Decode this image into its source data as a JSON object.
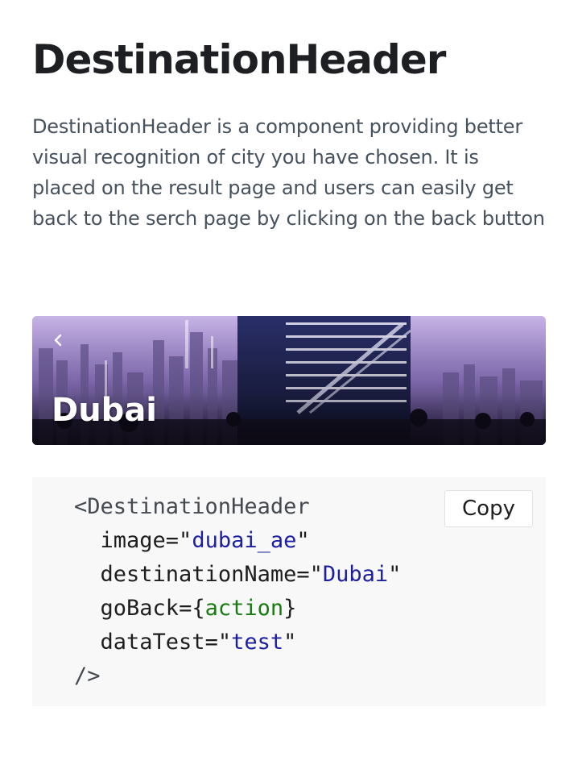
{
  "page": {
    "title": "DestinationHeader",
    "description": "DestinationHeader is a component providing better visual recognition of city you have chosen. It is placed on the result page and users can easily get back to the serch page by clicking on the back button"
  },
  "preview": {
    "destination_name": "Dubai",
    "back_icon": "chevron-left-icon"
  },
  "code": {
    "open_tag": "<DestinationHeader",
    "props": [
      {
        "name": "image",
        "op": "=\"",
        "value": "dubai_ae",
        "close": "\"",
        "kind": "str"
      },
      {
        "name": "destinationName",
        "op": "=\"",
        "value": "Dubai",
        "close": "\"",
        "kind": "str"
      },
      {
        "name": "goBack",
        "op": "={",
        "value": "action",
        "close": "}",
        "kind": "expr"
      },
      {
        "name": "dataTest",
        "op": "=\"",
        "value": "test",
        "close": "\"",
        "kind": "str"
      }
    ],
    "close_tag": "/>",
    "copy_label": "Copy"
  },
  "colors": {
    "string": "#1b1fa0",
    "expression": "#1a7a12",
    "code_background": "#f8f8f8"
  }
}
